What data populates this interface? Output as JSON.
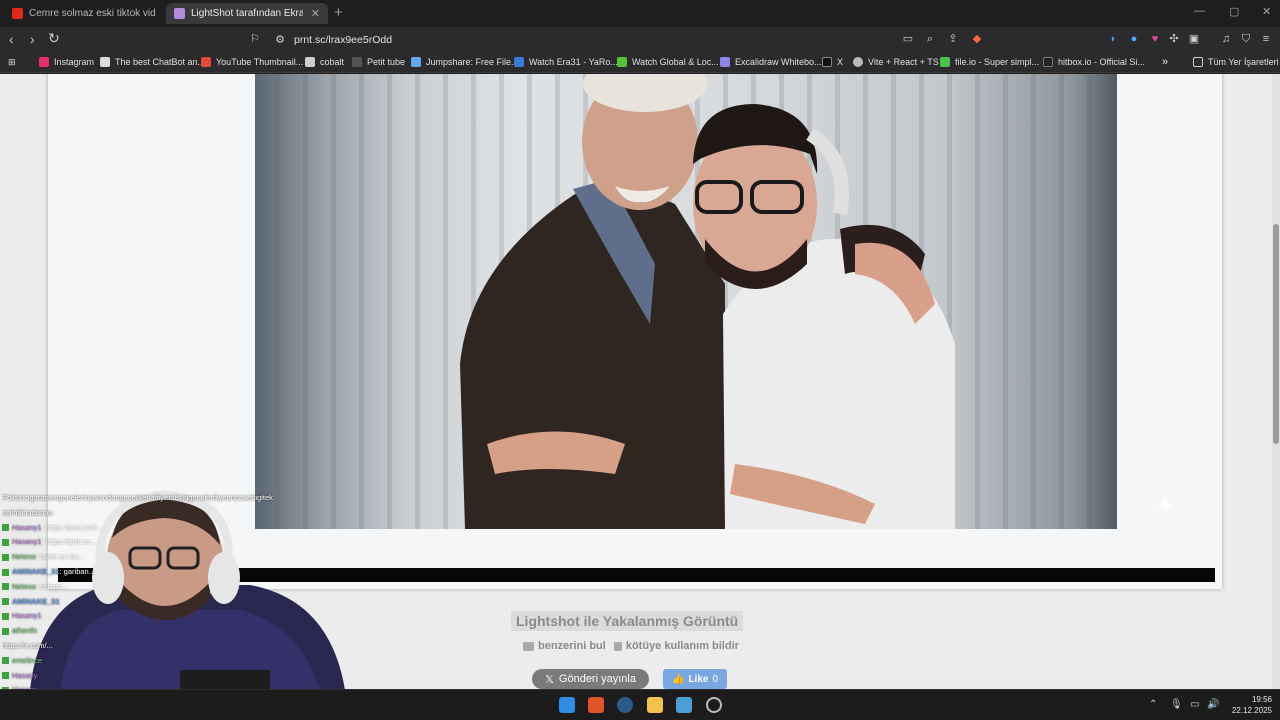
{
  "tabs": [
    {
      "title": "Cemre solmaz eski tiktok videosu izle",
      "favicon": "youtube-icon",
      "active": false
    },
    {
      "title": "LightShot tarafından Ekran Görüntü",
      "favicon": "lightshot-feather-icon",
      "active": true
    }
  ],
  "address_bar": {
    "url": "prnt.sc/lrax9ee5rOdd"
  },
  "bookmarks": [
    {
      "label": "Instagram",
      "icon": "instagram-icon",
      "color": "#e1306c"
    },
    {
      "label": "The best ChatBot an...",
      "icon": "chatbot-icon",
      "color": "#dddddd"
    },
    {
      "label": "YouTube Thumbnail...",
      "icon": "thumbnail-icon",
      "color": "#e04a3a"
    },
    {
      "label": "cobalt",
      "icon": "cobalt-icon",
      "color": "#cccccc"
    },
    {
      "label": "Petit tube",
      "icon": "petit-tube-icon",
      "color": "#444444"
    },
    {
      "label": "Jumpshare: Free File...",
      "icon": "jumpshare-icon",
      "color": "#6aa9e9"
    },
    {
      "label": "Watch Era31 - YaRo...",
      "icon": "twitch-icon",
      "color": "#3b7bd8"
    },
    {
      "label": "Watch Global & Loc...",
      "icon": "kick-icon",
      "color": "#53c23a"
    },
    {
      "label": "Excalidraw Whitebo...",
      "icon": "excalidraw-icon",
      "color": "#8d86e8"
    },
    {
      "label": "X",
      "icon": "x-icon",
      "color": "#222222"
    },
    {
      "label": "Vite + React + TS",
      "icon": "globe-icon",
      "color": "#bbbbbb"
    },
    {
      "label": "file.io - Super simpl...",
      "icon": "fileio-icon",
      "color": "#4cbf4c"
    },
    {
      "label": "hitbox.io - Official Si...",
      "icon": "hitbox-icon",
      "color": "#222222"
    }
  ],
  "bookmarks_folder": "Tüm Yer İşaretleri",
  "page": {
    "title": "Lightshot ile Yakalanmış Görüntü",
    "similar_link": "benzerini bul",
    "report_link": "kötüye kullanım bildir",
    "share_x": "Gönderi yayınla",
    "like_label": "Like",
    "like_count": "0"
  },
  "chat": [
    {
      "user": "",
      "text": "Polisincigarasiengenelerinyanindangecerkenaffiyetolsungenclerdiyeanonsettigitek",
      "color": "plain"
    },
    {
      "user": "",
      "text": "selirdiinadanaa",
      "color": "plain"
    },
    {
      "user": "Hasany1",
      "text": ": https://prnt.sc/lr...",
      "color": "u1"
    },
    {
      "user": "Hasany1",
      "text": ": https://prnt.sc...",
      "color": "u1"
    },
    {
      "user": "Netexo",
      "text": ": bizim en bu...",
      "color": "u2"
    },
    {
      "user": "AMINAKE_31",
      "text": ": gariban...",
      "color": "u3"
    },
    {
      "user": "Netexo",
      "text": ": milyon...",
      "color": "u2"
    },
    {
      "user": "AMINAKE_31",
      "text": "",
      "color": "u3"
    },
    {
      "user": "Hasany1",
      "text": ": ...",
      "color": "u1"
    },
    {
      "user": "athenfn",
      "text": "",
      "color": "u2"
    },
    {
      "user": "",
      "text": "https://x.com/...",
      "color": "plain"
    },
    {
      "user": "emelince",
      "text": "",
      "color": "u2"
    },
    {
      "user": "Hasany",
      "text": "",
      "color": "u1"
    },
    {
      "user": "Hasany",
      "text": "",
      "color": "u1"
    }
  ],
  "taskbar": {
    "apps": [
      {
        "name": "windows-start-icon",
        "color": "#2f8de4"
      },
      {
        "name": "brave-icon",
        "color": "#e0542a"
      },
      {
        "name": "steam-icon",
        "color": "#2a5a8a"
      },
      {
        "name": "file-explorer-icon",
        "color": "#f2c14e"
      },
      {
        "name": "control-panel-icon",
        "color": "#4a9fd8"
      },
      {
        "name": "app-icon",
        "color": "#bbbbbb"
      }
    ],
    "time": "19:56",
    "date": "22.12.2025"
  }
}
